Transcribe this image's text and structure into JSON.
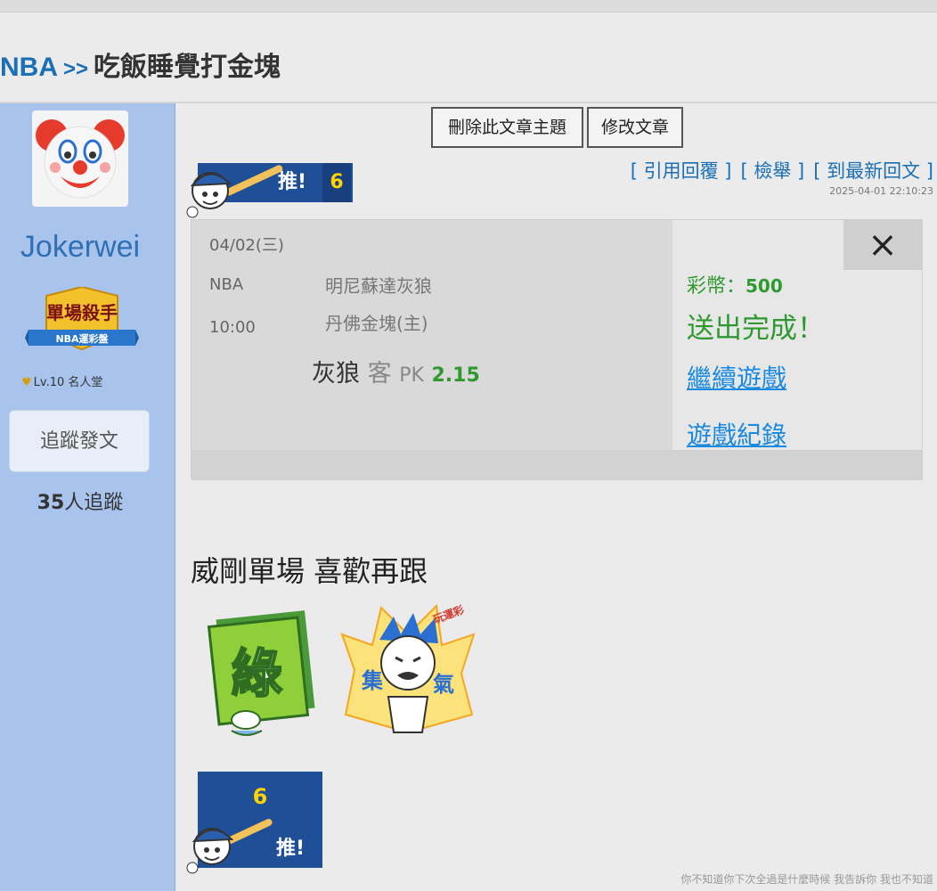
{
  "breadcrumb": {
    "board": "NBA",
    "separator": ">>",
    "title": "吃飯睡覺打金塊"
  },
  "sidebar": {
    "username": "Jokerwei",
    "badge_title": "單場殺手",
    "badge_sub": "NBA運彩盤",
    "level": "Lv.10 名人堂",
    "follow_button": "追蹤發文",
    "followers_count": "35",
    "followers_suffix": "人追蹤"
  },
  "actions": {
    "delete_topic": "刪除此文章主題",
    "edit_post": "修改文章"
  },
  "push": {
    "label": "推!",
    "count": "6"
  },
  "links": {
    "quote_reply": "[ 引用回覆 ]",
    "report": "[ 檢舉 ]",
    "latest_reply": "[ 到最新回文 ]"
  },
  "timestamp": "2025-04-01 22:10:23",
  "bet": {
    "date": "04/02(三)",
    "league": "NBA",
    "time": "10:00",
    "team_away": "明尼蘇達灰狼",
    "team_home": "丹佛金塊(主)",
    "pick_team": "灰狼",
    "pick_side": "客",
    "pick_type": "PK",
    "odds": "2.15",
    "coin_label": "彩幣：",
    "coin_amount": "500",
    "done_text": "送出完成！",
    "continue_link": "繼續遊戲",
    "records_link": "遊戲紀錄",
    "close_icon": "×"
  },
  "post": {
    "text": "威剛單場 喜歡再跟"
  },
  "stickers": {
    "green_char": "綠",
    "blue_left": "集",
    "blue_right": "氣",
    "blue_tag": "玩運彩"
  },
  "signature": "你不知道你下次全過是什麼時候 我告訴你 我也不知道",
  "colors": {
    "sidebar_bg": "#a9c4ec",
    "link_blue": "#1a6fb5",
    "push_blue": "#1f4f96",
    "success_green": "#2e9a2e",
    "count_yellow": "#ffd400"
  }
}
